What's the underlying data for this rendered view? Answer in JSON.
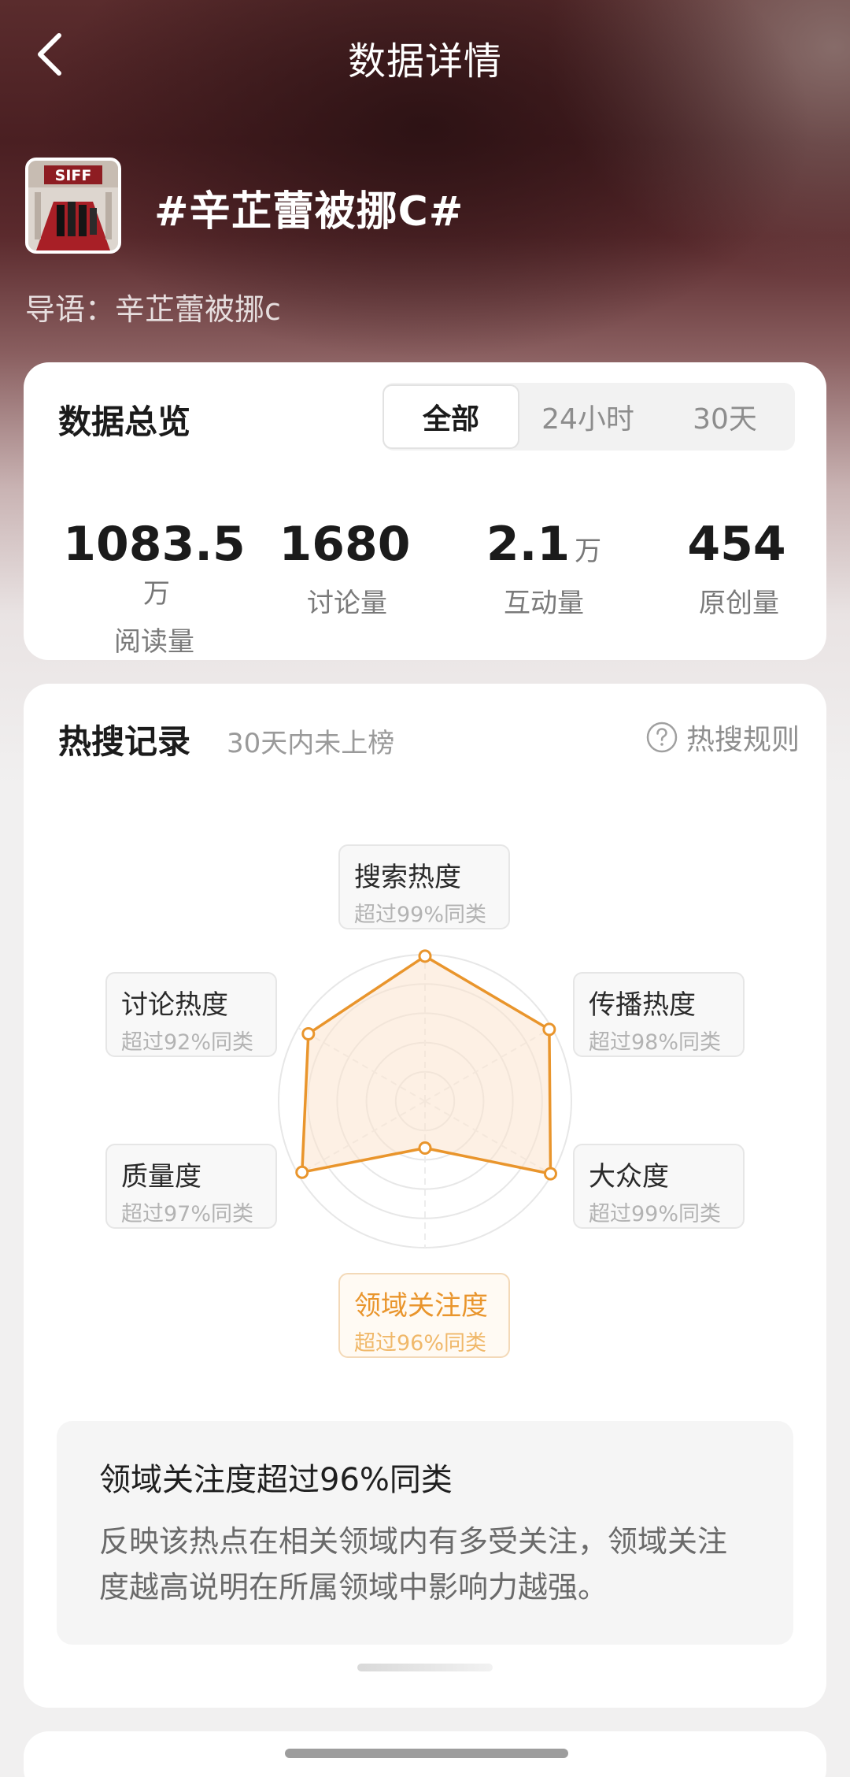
{
  "header": {
    "title": "数据详情",
    "back_icon": "chevron-left-icon"
  },
  "topic": {
    "title": "#辛芷蕾被挪C#",
    "intro": "导语：辛芷蕾被挪c",
    "thumb_sign_text": "SIFF"
  },
  "overview": {
    "heading": "数据总览",
    "tabs": [
      {
        "label": "全部",
        "active": true
      },
      {
        "label": "24小时",
        "active": false
      },
      {
        "label": "30天",
        "active": false
      }
    ],
    "stats": [
      {
        "value": "1083.5",
        "unit": "万",
        "label": "阅读量"
      },
      {
        "value": "1680",
        "unit": "",
        "label": "讨论量"
      },
      {
        "value": "2.1",
        "unit": "万",
        "label": "互动量"
      },
      {
        "value": "454",
        "unit": "",
        "label": "原创量"
      }
    ]
  },
  "hot_search": {
    "heading": "热搜记录",
    "subtitle": "30天内未上榜",
    "rules_label": "热搜规则",
    "rules_icon": "question-circle-icon",
    "dimensions": [
      {
        "name": "搜索热度",
        "percentile": "超过99%同类",
        "active": false
      },
      {
        "name": "传播热度",
        "percentile": "超过98%同类",
        "active": false
      },
      {
        "name": "大众度",
        "percentile": "超过99%同类",
        "active": false
      },
      {
        "name": "领域关注度",
        "percentile": "超过96%同类",
        "active": true
      },
      {
        "name": "质量度",
        "percentile": "超过97%同类",
        "active": false
      },
      {
        "name": "讨论热度",
        "percentile": "超过92%同类",
        "active": false
      }
    ],
    "radar_levels": [
      0.99,
      0.98,
      0.99,
      0.32,
      0.97,
      0.92
    ],
    "accent_color": "#e9952c",
    "description": {
      "title": "领域关注度超过96%同类",
      "text": "反映该热点在相关领域内有多受关注，领域关注度越高说明在所属领域中影响力越强。"
    }
  }
}
